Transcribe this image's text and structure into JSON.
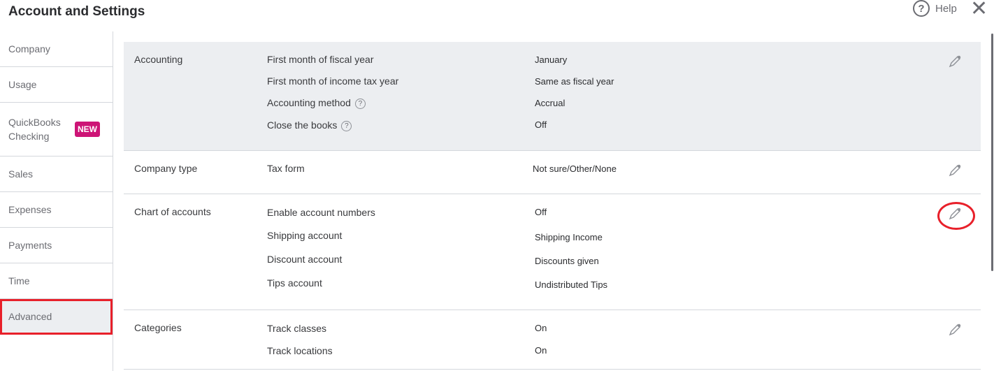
{
  "header": {
    "title": "Account and Settings",
    "help": "Help",
    "help_icon": "?",
    "close": "✕"
  },
  "sidebar": {
    "items": [
      {
        "label": "Company"
      },
      {
        "label": "Usage"
      },
      {
        "label": "QuickBooks Checking",
        "badge": "NEW"
      },
      {
        "label": "Sales"
      },
      {
        "label": "Expenses"
      },
      {
        "label": "Payments"
      },
      {
        "label": "Time"
      },
      {
        "label": "Advanced",
        "active": true
      }
    ]
  },
  "sections": [
    {
      "name": "Accounting",
      "rows": [
        {
          "label": "First month of fiscal year",
          "value": "January"
        },
        {
          "label": "First month of income tax year",
          "value": "Same as fiscal year"
        },
        {
          "label": "Accounting method",
          "value": "Accrual"
        },
        {
          "label": "Close the books",
          "value": "Off"
        }
      ]
    },
    {
      "name": "Company type",
      "rows": [
        {
          "label": "Tax form",
          "value": "Not sure/Other/None"
        }
      ]
    },
    {
      "name": "Chart of accounts",
      "rows": [
        {
          "label": "Enable account numbers",
          "value": "Off"
        },
        {
          "label": "Shipping account",
          "value": "Shipping Income"
        },
        {
          "label": "Discount account",
          "value": "Discounts given"
        },
        {
          "label": "Tips account",
          "value": "Undistributed Tips"
        }
      ]
    },
    {
      "name": "Categories",
      "rows": [
        {
          "label": "Track classes",
          "value": "On"
        },
        {
          "label": "Track locations",
          "value": "On"
        }
      ]
    }
  ]
}
